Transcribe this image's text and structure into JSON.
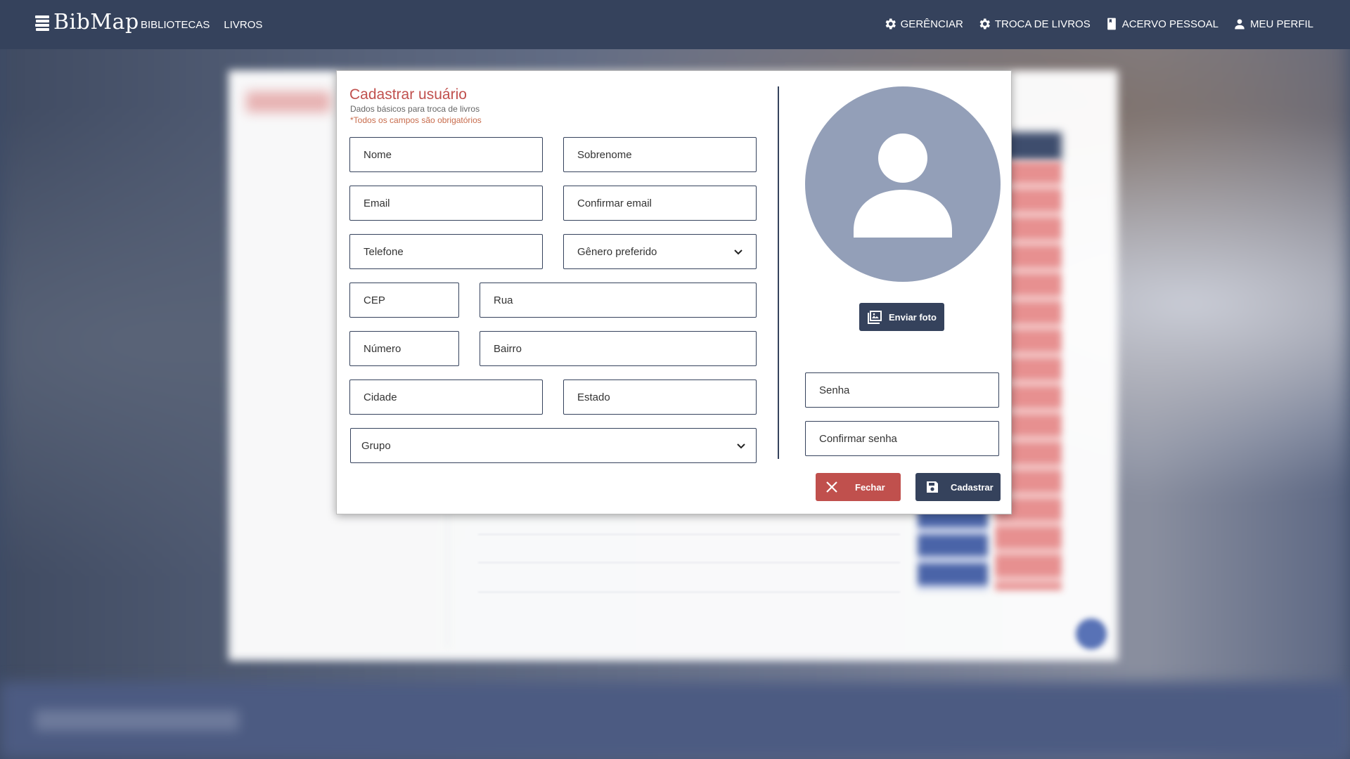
{
  "nav": {
    "logo": "BibMap",
    "left_items": [
      "BIBLIOTECAS",
      "LIVROS"
    ],
    "right_items": [
      {
        "label": "GERÊNCIAR",
        "icon": "gear-icon"
      },
      {
        "label": "TROCA DE LIVROS",
        "icon": "gear-icon"
      },
      {
        "label": "ACERVO PESSOAL",
        "icon": "book-icon"
      },
      {
        "label": "MEU PERFIL",
        "icon": "person-icon"
      }
    ]
  },
  "dialog": {
    "title": "Cadastrar usuário",
    "subtitle": "Dados básicos para troca de livros",
    "required_note": "*Todos os campos são obrigatórios",
    "fields": {
      "nome": "Nome",
      "sobrenome": "Sobrenome",
      "email": "Email",
      "confirmar_email": "Confirmar email",
      "telefone": "Telefone",
      "genero": "Gênero preferido",
      "cep": "CEP",
      "rua": "Rua",
      "numero": "Número",
      "bairro": "Bairro",
      "cidade": "Cidade",
      "estado": "Estado",
      "grupo": "Grupo",
      "senha": "Senha",
      "confirmar_senha": "Confirmar senha"
    },
    "buttons": {
      "upload": "Enviar foto",
      "close": "Fechar",
      "save": "Cadastrar"
    }
  },
  "colors": {
    "primary": "#35425c",
    "danger": "#c0504d",
    "avatar_bg": "#939fb8"
  }
}
